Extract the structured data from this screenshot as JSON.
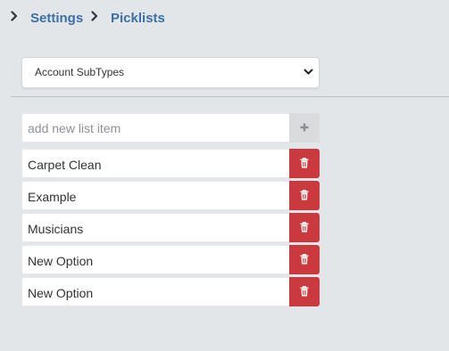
{
  "breadcrumb": {
    "items": [
      {
        "label": "Settings",
        "icon": "chevron-right-icon"
      },
      {
        "label": "Picklists",
        "icon": "chevron-right-icon"
      }
    ]
  },
  "picklist_select": {
    "value": "Account SubTypes",
    "icon": "chevron-down-icon"
  },
  "add_item": {
    "placeholder": "add new list item",
    "value": "",
    "button_icon": "plus-icon"
  },
  "list_items": [
    {
      "label": "Carpet Clean",
      "delete_icon": "trash-icon"
    },
    {
      "label": "Example",
      "delete_icon": "trash-icon"
    },
    {
      "label": "Musicians",
      "delete_icon": "trash-icon"
    },
    {
      "label": "New Option",
      "delete_icon": "trash-icon"
    },
    {
      "label": "New Option",
      "delete_icon": "trash-icon"
    }
  ],
  "colors": {
    "background": "#e3e6e9",
    "link": "#3b6fa6",
    "delete_button": "#c9393d",
    "add_button": "#d9dbdd",
    "divider": "#bfc3c7"
  }
}
